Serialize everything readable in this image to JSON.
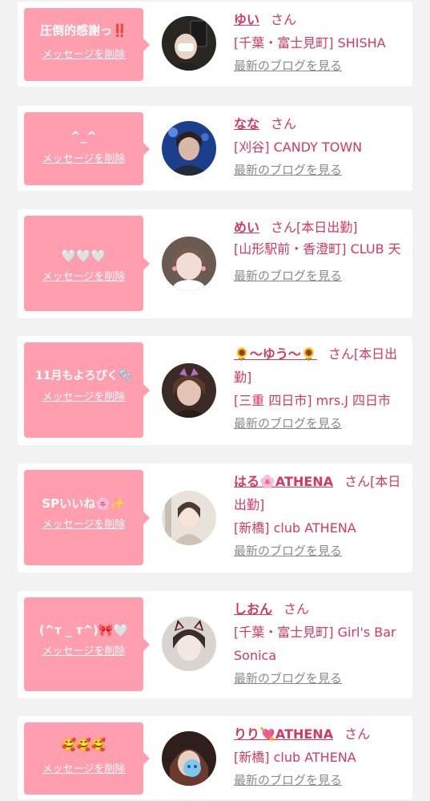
{
  "delete_label": "メッセージを削除",
  "blog_label": "最新のブログを見る",
  "san_label": "さん",
  "items": [
    {
      "message": "圧倒的感謝っ‼️",
      "name": "ゆい",
      "status": "",
      "shop": "[千葉・富士見町] SHISHA",
      "avatar_icon": "girl-photo-avatar"
    },
    {
      "message": "^_^",
      "name": "なな",
      "status": "",
      "shop": "[刈谷] CANDY TOWN",
      "avatar_icon": "girl-photo-avatar"
    },
    {
      "message": "🤍🤍🤍",
      "name": "めい",
      "status": "[本日出勤]",
      "shop": "[山形駅前・香澄町] CLUB 天",
      "avatar_icon": "girl-photo-avatar"
    },
    {
      "message": "11月もよろぴく🫧",
      "name": "🌻〜ゆう〜🌻",
      "status": "[本日出勤]",
      "shop": "[三重 四日市] mrs.J 四日市",
      "avatar_icon": "girl-photo-avatar"
    },
    {
      "message": "SPいいね🌸✨",
      "name": "はる🌸ATHENA",
      "status": "[本日出勤]",
      "shop": "[新橋] club ATHENA",
      "avatar_icon": "girl-photo-avatar"
    },
    {
      "message": "(^т _ т^)🎀🤍",
      "name": "しおん",
      "status": "",
      "shop": "[千葉・富士見町] Girl's Bar Sonica",
      "avatar_icon": "girl-photo-avatar"
    },
    {
      "message": "🥰🥰🥰",
      "name": "りり💘ATHENA",
      "status": "",
      "shop": "[新橋] club ATHENA",
      "avatar_icon": "girl-photo-avatar"
    }
  ]
}
